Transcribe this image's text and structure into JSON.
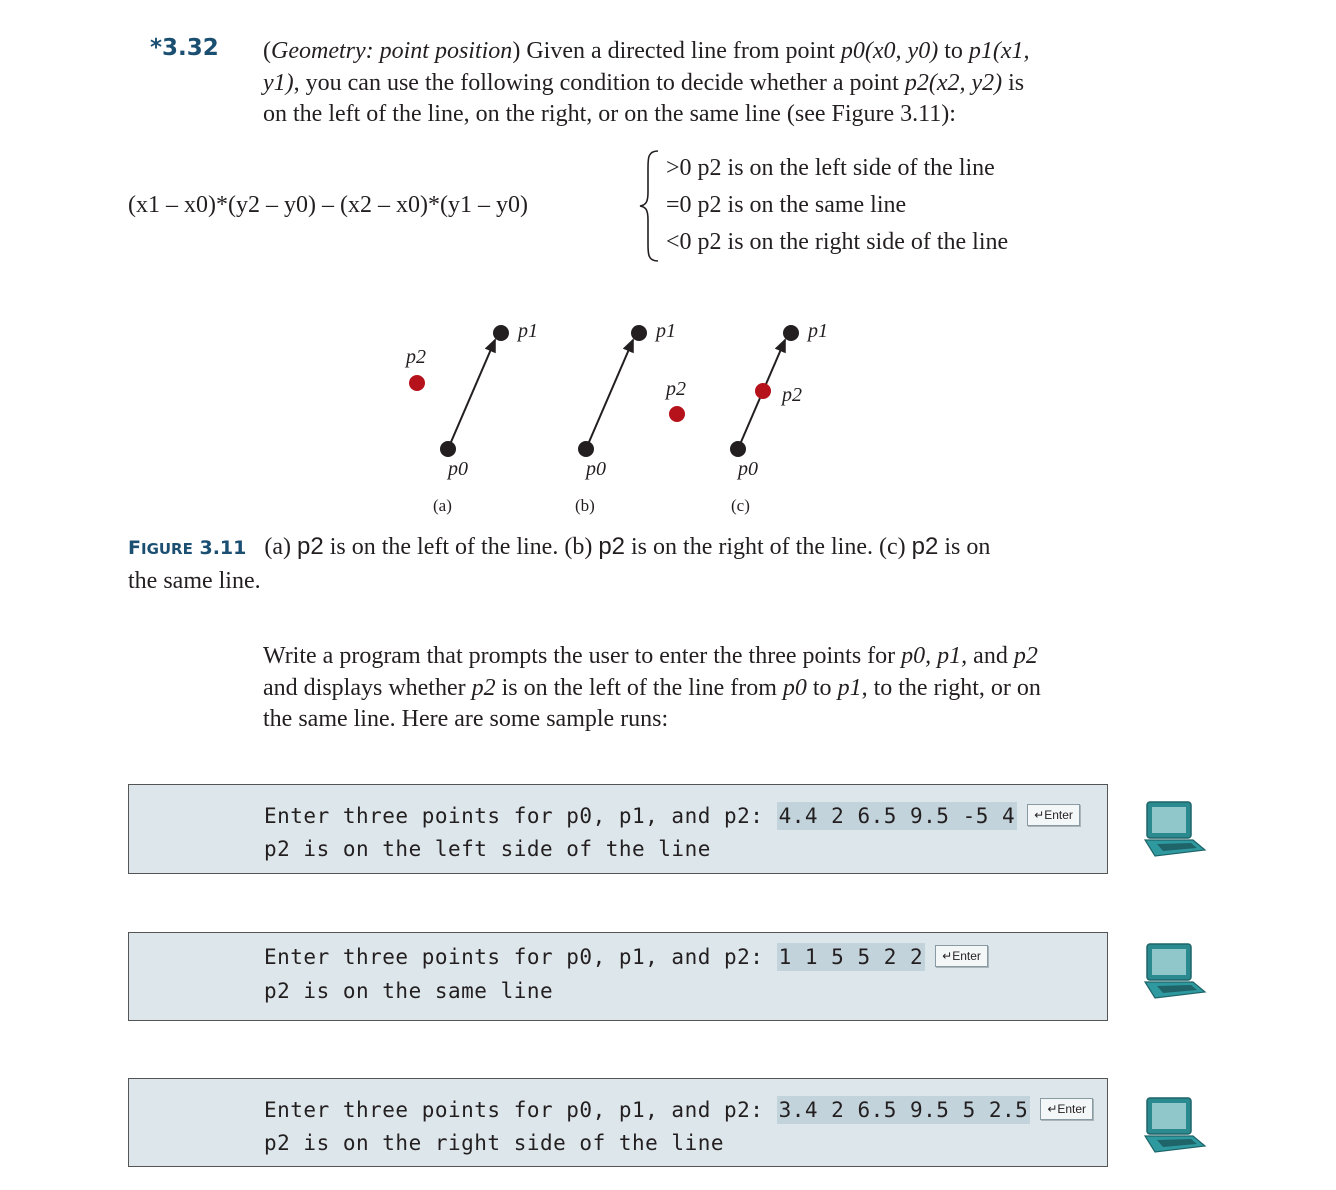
{
  "exercise": {
    "number": "*3.32",
    "title": "Geometry: point position",
    "intro_line1_rest": " Given a directed line from point ",
    "p0x0y0": "p0(x0, y0)",
    "to": " to ",
    "p1x1": "p1(x1,",
    "intro_line2_start": "y1)",
    "intro_line2_rest": ", you can use the following condition to decide whether a point ",
    "p2x2y2": "p2(x2, y2)",
    "is": " is",
    "intro_line3": "on the left of the line, on the right, or on the same line (see Figure 3.11):"
  },
  "formula": {
    "expression": "(x1 – x0)*(y2 – y0) – (x2 – x0)*(y1 – y0)",
    "cases": [
      ">0 p2 is on the left side of the line",
      "=0 p2 is on the same line",
      "<0 p2 is on the right side of the line"
    ]
  },
  "figure": {
    "labels": {
      "p0": "p0",
      "p1": "p1",
      "p2": "p2"
    },
    "sub_labels": [
      "(a)",
      "(b)",
      "(c)"
    ],
    "caption_label_first": "F",
    "caption_label_small": "IGURE",
    "caption_label_num": "3.11",
    "caption_parts": [
      "(a) ",
      "p2",
      " is on the left of the line. (b) ",
      "p2",
      " is on the right of the line. (c) ",
      "p2",
      " is on"
    ],
    "caption_line2": "the same line.",
    "colors": {
      "point_black": "#231f20",
      "point_red": "#b5121b"
    }
  },
  "task": {
    "line1_prefix": "Write a program that prompts the user to enter the three points for ",
    "line1_vars": "p0, p1,",
    "line1_and": " and ",
    "line1_p2": "p2",
    "line2_prefix": "and displays whether ",
    "line2_p2": "p2",
    "line2_mid": " is on the left of the line from ",
    "line2_p0": "p0",
    "line2_to": " to ",
    "line2_p1": "p1",
    "line2_end": ", to the right, or on",
    "line3": "the same line. Here are some sample runs:"
  },
  "sample_runs": [
    {
      "prompt": "Enter three points for p0, p1, and p2: ",
      "input": "4.4 2 6.5 9.5 -5 4",
      "enter_key": "↵Enter",
      "output": "p2 is on the left side of the line"
    },
    {
      "prompt": "Enter three points for p0, p1, and p2: ",
      "input": "1 1 5 5 2 2",
      "enter_key": "↵Enter",
      "output": "p2 is on the same line"
    },
    {
      "prompt": "Enter three points for p0, p1, and p2: ",
      "input": "3.4 2 6.5 9.5 5 2.5",
      "enter_key": "↵Enter",
      "output": "p2 is on the right side of the line"
    }
  ],
  "icons": {
    "run_icon": "laptop-icon"
  }
}
